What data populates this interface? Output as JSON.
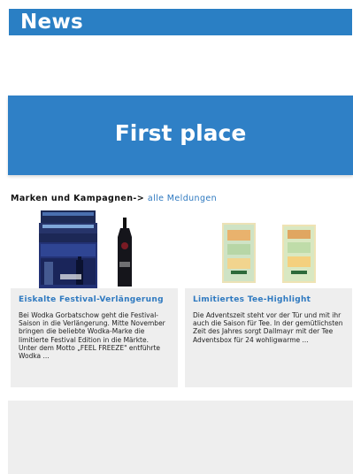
{
  "header": {
    "title": "News"
  },
  "hero": {
    "title": "First place"
  },
  "breadcrumb": {
    "section": "Marken und Kampagnen",
    "arrow": "->",
    "link": "alle Meldungen"
  },
  "cards": [
    {
      "image": "vodka-bottles-image",
      "headline": "Eiskalte Festival-Verlängerung",
      "text": "Bei Wodka Gorbatschow geht die Festival-Saison in die Verlängerung. Mitte November bringen die beliebte Wodka-Marke die limitierte Festival Edition in die Märkte. Unter dem Motto „FEEL FREEZE\" entführte Wodka ..."
    },
    {
      "image": "tea-advent-box-image",
      "headline": "Limitiertes Tee-Highlight",
      "text": "Die Adventszeit steht vor der Tür und mit ihr auch die Saison für Tee. In der gemütlichsten Zeit des Jahres sorgt Dallmayr mit der Tee Adventsbox für 24 wohligwarme ..."
    }
  ]
}
